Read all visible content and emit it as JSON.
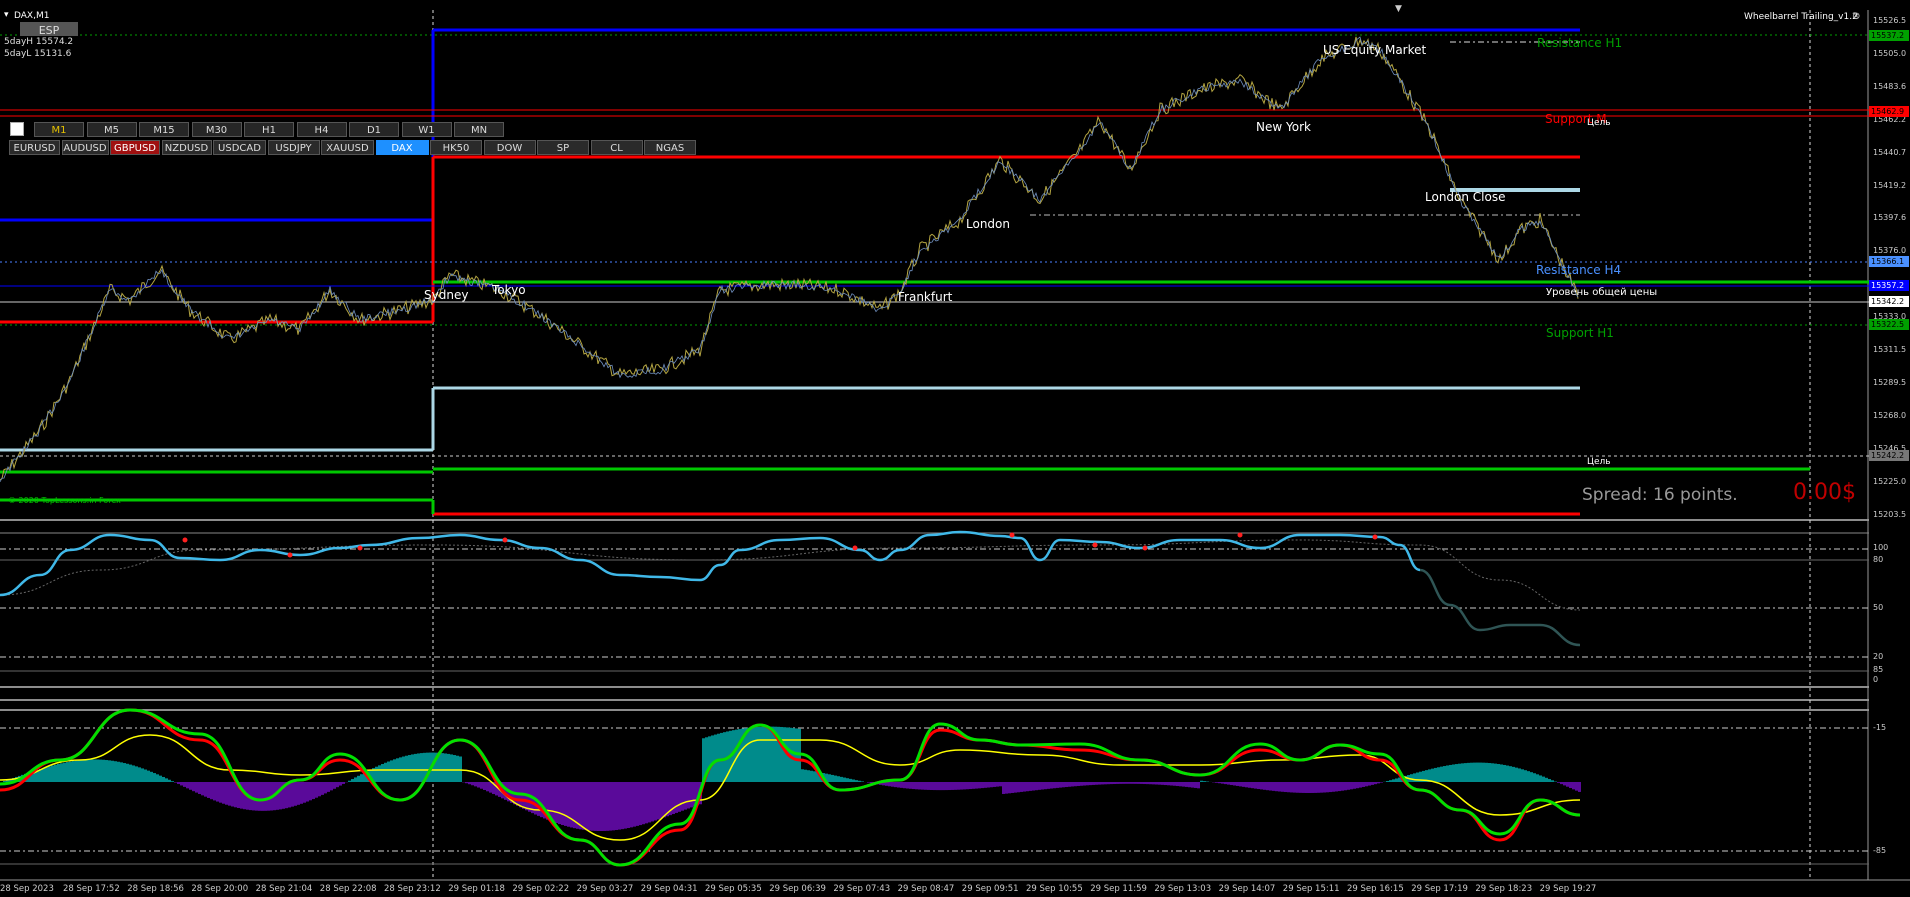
{
  "window": {
    "symbol_title": "DAX,M1",
    "esp_button": "ESP",
    "five_day_high": "5dayH 15574.2",
    "five_day_low": "5dayL 15131.6",
    "indicator_name": "Wheelbarrel Trailing_v1.2",
    "copyright": "© 2020 TopLessons.in Forex"
  },
  "timeframes": [
    "M1",
    "M5",
    "M15",
    "M30",
    "H1",
    "H4",
    "D1",
    "W1",
    "MN"
  ],
  "active_timeframe": "M1",
  "symbols": [
    "EURUSD",
    "AUDUSD",
    "GBPUSD",
    "NZDUSD",
    "USDCAD",
    "USDJPY",
    "XAUUSD",
    "DAX",
    "HK50",
    "DOW",
    "SP",
    "CL",
    "NGAS"
  ],
  "highlighted_symbol": "GBPUSD",
  "active_symbol": "DAX",
  "sessions": {
    "sydney": "Sydney",
    "tokyo": "Tokyo",
    "frankfurt": "Frankfurt",
    "london": "London",
    "new_york": "New York",
    "us_equity": "US Equity Market",
    "london_close": "London Close"
  },
  "levels": {
    "resistance_h1": "Resistance H1",
    "support_m": "Support M",
    "target_1": "Цель",
    "resistance_h4": "Resistance H4",
    "general_price": "Уровень общей цены",
    "support_h1": "Support H1",
    "target_2": "Цель"
  },
  "spread_text": "Spread: 16 points.",
  "profit_text": "0.00$",
  "price_axis": [
    "15526.5",
    "15505.0",
    "15483.6",
    "15462.2",
    "15440.7",
    "15419.2",
    "15397.6",
    "15376.0",
    "15354.6",
    "15333.0",
    "15311.5",
    "15289.5",
    "15268.0",
    "15246.5",
    "15225.0",
    "15203.5"
  ],
  "price_tags": {
    "resistance_h1": "15537.2",
    "support_m": "15462.9",
    "resistance_h4": "15366.1",
    "blue_level": "15357.2",
    "current": "15342.2",
    "support_h1": "15322.5",
    "target": "15242.2"
  },
  "indicator1_axis": [
    "100",
    "80",
    "50",
    "20",
    "0"
  ],
  "indicator2_axis": [
    "85",
    "-15",
    "-85"
  ],
  "indicator3_axis": [
    "15",
    "-15",
    "-85"
  ],
  "time_axis": [
    "28 Sep 2023",
    "28 Sep 17:52",
    "28 Sep 18:56",
    "28 Sep 20:00",
    "28 Sep 21:04",
    "28 Sep 22:08",
    "28 Sep 23:12",
    "29 Sep 01:18",
    "29 Sep 02:22",
    "29 Sep 03:27",
    "29 Sep 04:31",
    "29 Sep 05:35",
    "29 Sep 06:39",
    "29 Sep 07:43",
    "29 Sep 08:47",
    "29 Sep 09:51",
    "29 Sep 10:55",
    "29 Sep 11:59",
    "29 Sep 13:03",
    "29 Sep 14:07",
    "29 Sep 15:11",
    "29 Sep 16:15",
    "29 Sep 17:19",
    "29 Sep 18:23",
    "29 Sep 19:27"
  ],
  "colors": {
    "background": "#000000",
    "price_line": "#b5a642",
    "resistance": "#ff0000",
    "support": "#00c800",
    "blue_level": "#0000ff",
    "light_blue": "#87ceeb",
    "active_symbol": "#1e90ff",
    "indicator_line": "#40b8e8",
    "teal_histogram": "#008b8b",
    "purple_histogram": "#5a0a9a"
  }
}
